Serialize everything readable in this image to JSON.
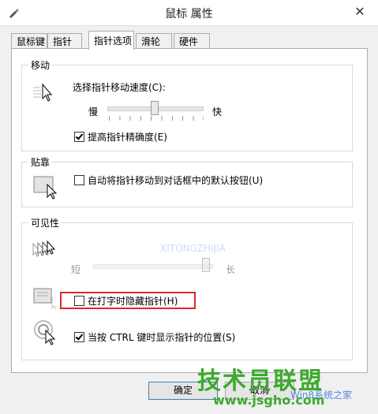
{
  "window": {
    "title": "鼠标 属性",
    "close_glyph": "✕"
  },
  "tabs": [
    {
      "label": "鼠标键",
      "active": false
    },
    {
      "label": "指针",
      "active": false
    },
    {
      "label": "指针选项",
      "active": true
    },
    {
      "label": "滑轮",
      "active": false
    },
    {
      "label": "硬件",
      "active": false
    }
  ],
  "motion": {
    "title": "移动",
    "speed_label": "选择指针移动速度(C):",
    "slow": "慢",
    "fast": "快",
    "speed_value": 0.5,
    "precision_label": "提高指针精确度(E)",
    "precision_checked": true
  },
  "snap": {
    "title": "贴靠",
    "snap_label": "自动将指针移动到对话框中的默认按钮(U)",
    "snap_checked": false
  },
  "visibility": {
    "title": "可见性",
    "trail_short": "短",
    "trail_long": "长",
    "trail_value": 1.0,
    "hide_label": "在打字时隐藏指针(H)",
    "hide_checked": false,
    "ctrl_label": "当按 CTRL 键时显示指针的位置(S)",
    "ctrl_checked": true
  },
  "buttons": {
    "ok": "确定",
    "cancel": "取消"
  },
  "watermark": {
    "brand": "技术员联盟",
    "url": "www.jsgho.com",
    "secondary": "Win8系统之家",
    "faint": "XITONGZHIJIA"
  },
  "icons": {
    "title": "mouse-icon",
    "motion": "pointer-speed-icon",
    "snap": "snap-to-icon",
    "trails": "pointer-trails-icon",
    "hide": "hide-pointer-icon",
    "ctrl": "show-location-icon"
  },
  "colors": {
    "highlight": "#e0262c",
    "watermark": "#3daa2e"
  }
}
